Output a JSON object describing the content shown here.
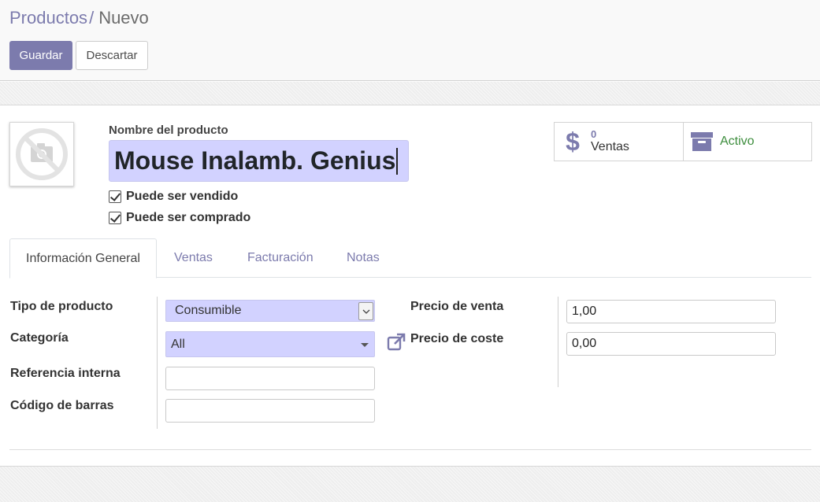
{
  "breadcrumb": {
    "parent": "Productos",
    "separator": "/",
    "current": "Nuevo"
  },
  "toolbar": {
    "save_label": "Guardar",
    "discard_label": "Descartar"
  },
  "product": {
    "name_label": "Nombre del producto",
    "name_value": "Mouse Inalamb. Genius",
    "can_be_sold": {
      "label": "Puede ser vendido",
      "checked": true
    },
    "can_be_purchased": {
      "label": "Puede ser comprado",
      "checked": true
    },
    "image_icon": "camera-placeholder-icon"
  },
  "smart_buttons": {
    "sales": {
      "value": "0",
      "label": "Ventas",
      "icon": "dollar-icon"
    },
    "active": {
      "label": "Activo",
      "icon": "archive-icon"
    }
  },
  "tabs": [
    {
      "label": "Información General",
      "active": true
    },
    {
      "label": "Ventas",
      "active": false
    },
    {
      "label": "Facturación",
      "active": false
    },
    {
      "label": "Notas",
      "active": false
    }
  ],
  "general": {
    "product_type": {
      "label": "Tipo de producto",
      "value": "Consumible"
    },
    "category": {
      "label": "Categoría",
      "value": "All"
    },
    "internal_reference": {
      "label": "Referencia interna",
      "value": ""
    },
    "barcode": {
      "label": "Código de barras",
      "value": ""
    },
    "sale_price": {
      "label": "Precio de venta",
      "value": "1,00"
    },
    "cost_price": {
      "label": "Precio de coste",
      "value": "0,00"
    }
  },
  "colors": {
    "accent": "#7c7bad",
    "field_highlight": "#d2d2ff",
    "active_green": "#3e8e3e"
  }
}
